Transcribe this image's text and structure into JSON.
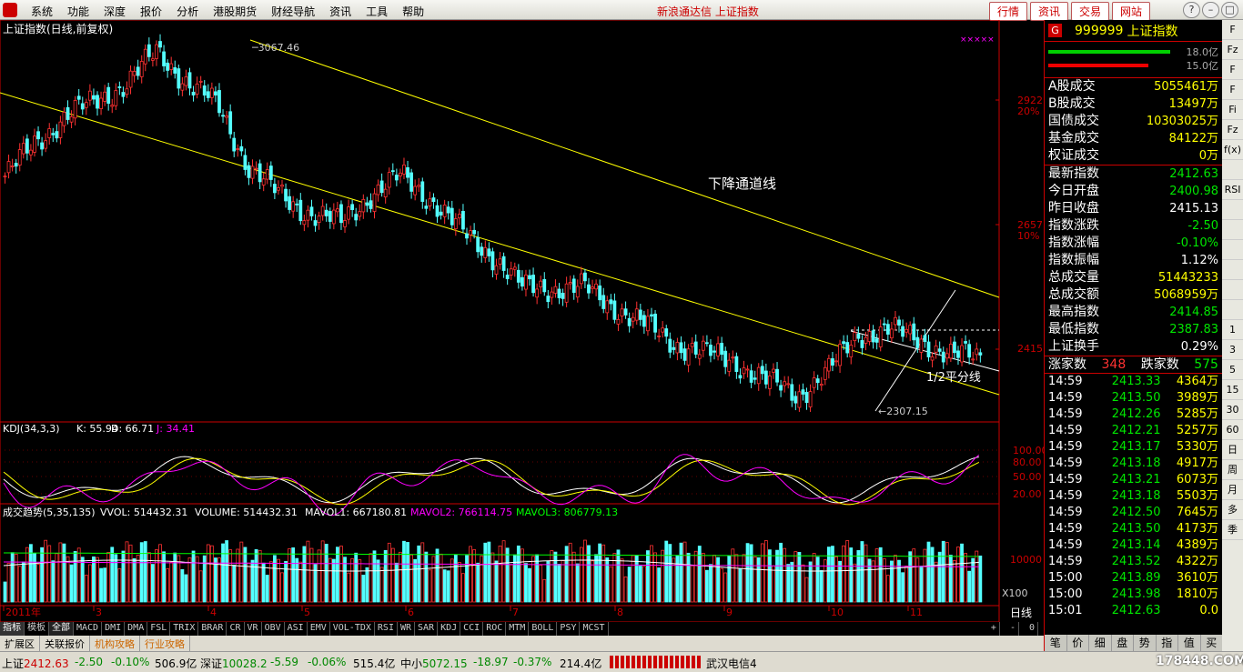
{
  "menubar": {
    "items": [
      "系统",
      "功能",
      "深度",
      "报价",
      "分析",
      "港股期货",
      "财经导航",
      "资讯",
      "工具",
      "帮助"
    ],
    "title": "新浪通达信 上证指数",
    "right_buttons": [
      "行情",
      "资讯",
      "交易",
      "网站"
    ]
  },
  "chart": {
    "main_title": "上证指数(日线,前复权)",
    "high_label": "3067.46",
    "low_label": "2307.15",
    "annotation_channel": "下降通道线",
    "annotation_half": "1/2平分线",
    "y_labels": [
      "2922",
      "20%",
      "2657",
      "10%",
      "2415"
    ],
    "months": [
      "2011年",
      "3",
      "4",
      "5",
      "6",
      "7",
      "8",
      "9",
      "10",
      "11"
    ],
    "marker": "×××××",
    "kdj": {
      "name": "KDJ(34,3,3)",
      "k": "K: 55.94",
      "d": "D: 66.71",
      "j": "J: 34.41",
      "levels": [
        "100.00",
        "80.00",
        "50.00",
        "20.00"
      ]
    },
    "vol": {
      "name": "成交趋势(5,35,135)",
      "vvol": "VVOL: 514432.31",
      "volume": "VOLUME: 514432.31",
      "mavol1": "MAVOL1: 667180.81",
      "mavol2": "MAVOL2: 766114.75",
      "mavol3": "MAVOL3: 806779.13",
      "level": "10000",
      "unit": "X100"
    },
    "period": "日线"
  },
  "tabs": [
    "指标",
    "模板",
    "全部",
    "MACD",
    "DMI",
    "DMA",
    "FSL",
    "TRIX",
    "BRAR",
    "CR",
    "VR",
    "OBV",
    "ASI",
    "EMV",
    "VOL-TDX",
    "RSI",
    "WR",
    "SAR",
    "KDJ",
    "CCI",
    "ROC",
    "MTM",
    "BOLL",
    "PSY",
    "MCST"
  ],
  "zoom": [
    "+",
    "-",
    "0"
  ],
  "extabs": [
    "扩展区",
    "关联报价",
    "机构攻略",
    "行业攻略"
  ],
  "info": {
    "code": "999999",
    "name": "上证指数",
    "bar1": "18.0亿",
    "bar2": "15.0亿",
    "trade": [
      {
        "label": "A股成交",
        "value": "5055461万"
      },
      {
        "label": "B股成交",
        "value": "13497万"
      },
      {
        "label": "国债成交",
        "value": "10303025万"
      },
      {
        "label": "基金成交",
        "value": "84122万"
      },
      {
        "label": "权证成交",
        "value": "0万"
      }
    ],
    "stats": [
      {
        "label": "最新指数",
        "value": "2412.63",
        "c": "green"
      },
      {
        "label": "今日开盘",
        "value": "2400.98",
        "c": "green"
      },
      {
        "label": "昨日收盘",
        "value": "2415.13",
        "c": "white"
      },
      {
        "label": "指数涨跌",
        "value": "-2.50",
        "c": "green"
      },
      {
        "label": "指数涨幅",
        "value": "-0.10%",
        "c": "green"
      },
      {
        "label": "指数振幅",
        "value": "1.12%",
        "c": "white"
      },
      {
        "label": "总成交量",
        "value": "51443233",
        "c": "yellow"
      },
      {
        "label": "总成交额",
        "value": "5068959万",
        "c": "yellow"
      },
      {
        "label": "最高指数",
        "value": "2414.85",
        "c": "green"
      },
      {
        "label": "最低指数",
        "value": "2387.83",
        "c": "green"
      },
      {
        "label": "上证换手",
        "value": "0.29%",
        "c": "white"
      }
    ],
    "updown": {
      "up_label": "涨家数",
      "up": "348",
      "down_label": "跌家数",
      "down": "575"
    },
    "ticks": [
      [
        "14:59",
        "2413.33",
        "4364万"
      ],
      [
        "14:59",
        "2413.50",
        "3989万"
      ],
      [
        "14:59",
        "2412.26",
        "5285万"
      ],
      [
        "14:59",
        "2412.21",
        "5257万"
      ],
      [
        "14:59",
        "2413.17",
        "5330万"
      ],
      [
        "14:59",
        "2413.18",
        "4917万"
      ],
      [
        "14:59",
        "2413.21",
        "6073万"
      ],
      [
        "14:59",
        "2413.18",
        "5503万"
      ],
      [
        "14:59",
        "2412.50",
        "7645万"
      ],
      [
        "14:59",
        "2413.50",
        "4173万"
      ],
      [
        "14:59",
        "2413.14",
        "4389万"
      ],
      [
        "14:59",
        "2413.52",
        "4322万"
      ],
      [
        "15:00",
        "2413.89",
        "3610万"
      ],
      [
        "15:00",
        "2413.98",
        "1810万"
      ],
      [
        "15:01",
        "2412.63",
        "0.0"
      ]
    ],
    "bottom_tabs": [
      "笔",
      "价",
      "细",
      "盘",
      "势",
      "指",
      "值",
      "买"
    ]
  },
  "rtool": [
    "F",
    "Fz",
    "F",
    "F",
    "Fi",
    "Fz",
    "f(x)",
    "",
    "RSI",
    "",
    "",
    "",
    "",
    "",
    "",
    "1",
    "3",
    "5",
    "15",
    "30",
    "60",
    "日",
    "周",
    "月",
    "多",
    "季"
  ],
  "status": {
    "sh_label": "上证",
    "sh": "2412.63",
    "sh_chg": "-2.50",
    "sh_pct": "-0.10%",
    "sh_amt": "506.9亿",
    "sz_label": "深证",
    "sz": "10028.2",
    "sz_chg": "-5.59",
    "sz_pct": "-0.06%",
    "sz_amt": "515.4亿",
    "zx_label": "中小",
    "zx": "5072.15",
    "zx_chg": "-18.97",
    "zx_pct": "-0.37%",
    "zx_amt": "214.4亿",
    "net": "武汉电信4",
    "watermark": "178448.COM"
  },
  "chart_data": {
    "type": "candlestick",
    "title": "上证指数(日线,前复权)",
    "x": [
      "2011年",
      "3",
      "4",
      "5",
      "6",
      "7",
      "8",
      "9",
      "10",
      "11"
    ],
    "y_ticks": [
      2922,
      2657,
      2415
    ],
    "high": 3067.46,
    "low": 2307.15,
    "series": [
      {
        "name": "上证指数",
        "values": [
          2800,
          2870,
          2930,
          2960,
          3000,
          3067,
          3000,
          2950,
          2820,
          2760,
          2720,
          2700,
          2760,
          2800,
          2750,
          2680,
          2630,
          2560,
          2560,
          2560,
          2520,
          2480,
          2440,
          2420,
          2400,
          2360,
          2330,
          2380,
          2460,
          2470,
          2450,
          2415,
          2412
        ]
      }
    ],
    "kdj": {
      "K": 55.94,
      "D": 66.71,
      "J": 34.41
    }
  }
}
